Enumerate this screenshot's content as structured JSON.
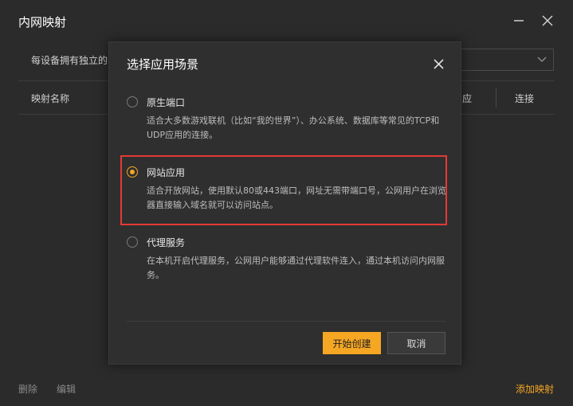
{
  "window": {
    "title": "内网映射"
  },
  "main": {
    "description_partial": "每设备拥有独立的",
    "table_headers": {
      "name": "映射名称",
      "mid": "应",
      "connect": "连接"
    }
  },
  "footer": {
    "delete": "删除",
    "edit": "编辑",
    "add": "添加映射"
  },
  "dialog": {
    "title": "选择应用场景",
    "options": [
      {
        "label": "原生端口",
        "desc": "适合大多数游戏联机（比如“我的世界”）、办公系统、数据库等常见的TCP和UDP应用的连接。",
        "selected": false
      },
      {
        "label": "网站应用",
        "desc": "适合开放网站，使用默认80或443端口，网址无需带端口号，公网用户在浏览器直接输入域名就可以访问站点。",
        "selected": true
      },
      {
        "label": "代理服务",
        "desc": "在本机开启代理服务，公网用户能够通过代理软件连入，通过本机访问内网服务。",
        "selected": false
      }
    ],
    "primary_button": "开始创建",
    "cancel_button": "取消"
  },
  "colors": {
    "accent": "#f5a623",
    "highlight": "#e53935",
    "background": "#2b2b2b",
    "dialog": "#2f2f2f"
  },
  "icons": {
    "minimize": "minimize-icon",
    "close": "close-icon",
    "dropdown": "chevron-down-icon"
  }
}
